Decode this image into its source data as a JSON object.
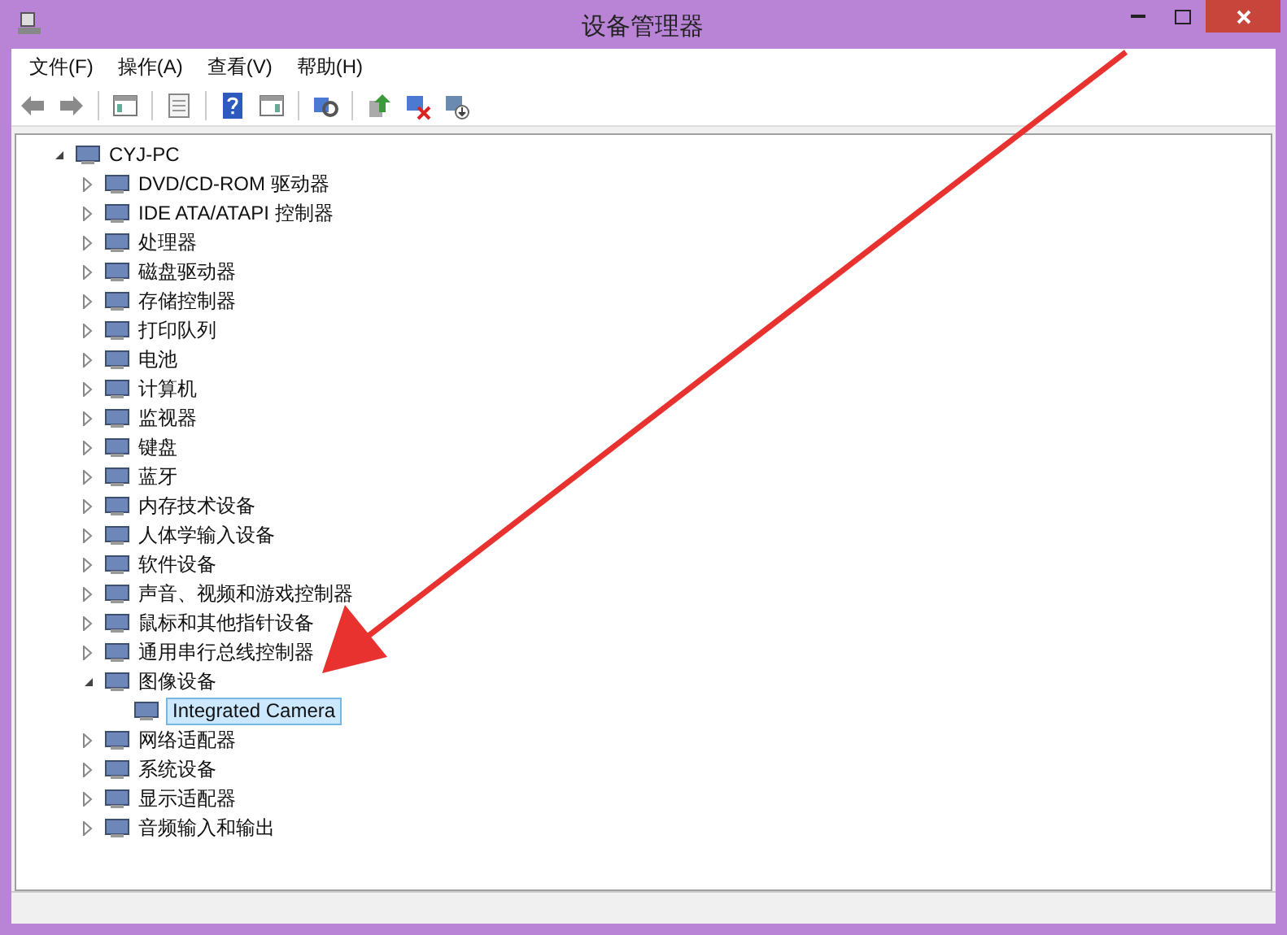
{
  "window": {
    "title": "设备管理器"
  },
  "menu": [
    "文件(F)",
    "操作(A)",
    "查看(V)",
    "帮助(H)"
  ],
  "tree": {
    "label": "CYJ-PC",
    "expanded": true,
    "selected": false,
    "children": [
      {
        "label": "DVD/CD-ROM 驱动器",
        "expanded": false,
        "selected": false
      },
      {
        "label": "IDE ATA/ATAPI 控制器",
        "expanded": false,
        "selected": false
      },
      {
        "label": "处理器",
        "expanded": false,
        "selected": false
      },
      {
        "label": "磁盘驱动器",
        "expanded": false,
        "selected": false
      },
      {
        "label": "存储控制器",
        "expanded": false,
        "selected": false
      },
      {
        "label": "打印队列",
        "expanded": false,
        "selected": false
      },
      {
        "label": "电池",
        "expanded": false,
        "selected": false
      },
      {
        "label": "计算机",
        "expanded": false,
        "selected": false
      },
      {
        "label": "监视器",
        "expanded": false,
        "selected": false
      },
      {
        "label": "键盘",
        "expanded": false,
        "selected": false
      },
      {
        "label": "蓝牙",
        "expanded": false,
        "selected": false
      },
      {
        "label": "内存技术设备",
        "expanded": false,
        "selected": false
      },
      {
        "label": "人体学输入设备",
        "expanded": false,
        "selected": false
      },
      {
        "label": "软件设备",
        "expanded": false,
        "selected": false
      },
      {
        "label": "声音、视频和游戏控制器",
        "expanded": false,
        "selected": false
      },
      {
        "label": "鼠标和其他指针设备",
        "expanded": false,
        "selected": false
      },
      {
        "label": "通用串行总线控制器",
        "expanded": false,
        "selected": false
      },
      {
        "label": "图像设备",
        "expanded": true,
        "selected": false,
        "children": [
          {
            "label": "Integrated Camera",
            "selected": true
          }
        ]
      },
      {
        "label": "网络适配器",
        "expanded": false,
        "selected": false
      },
      {
        "label": "系统设备",
        "expanded": false,
        "selected": false
      },
      {
        "label": "显示适配器",
        "expanded": false,
        "selected": false
      },
      {
        "label": "音频输入和输出",
        "expanded": false,
        "selected": false
      }
    ]
  }
}
